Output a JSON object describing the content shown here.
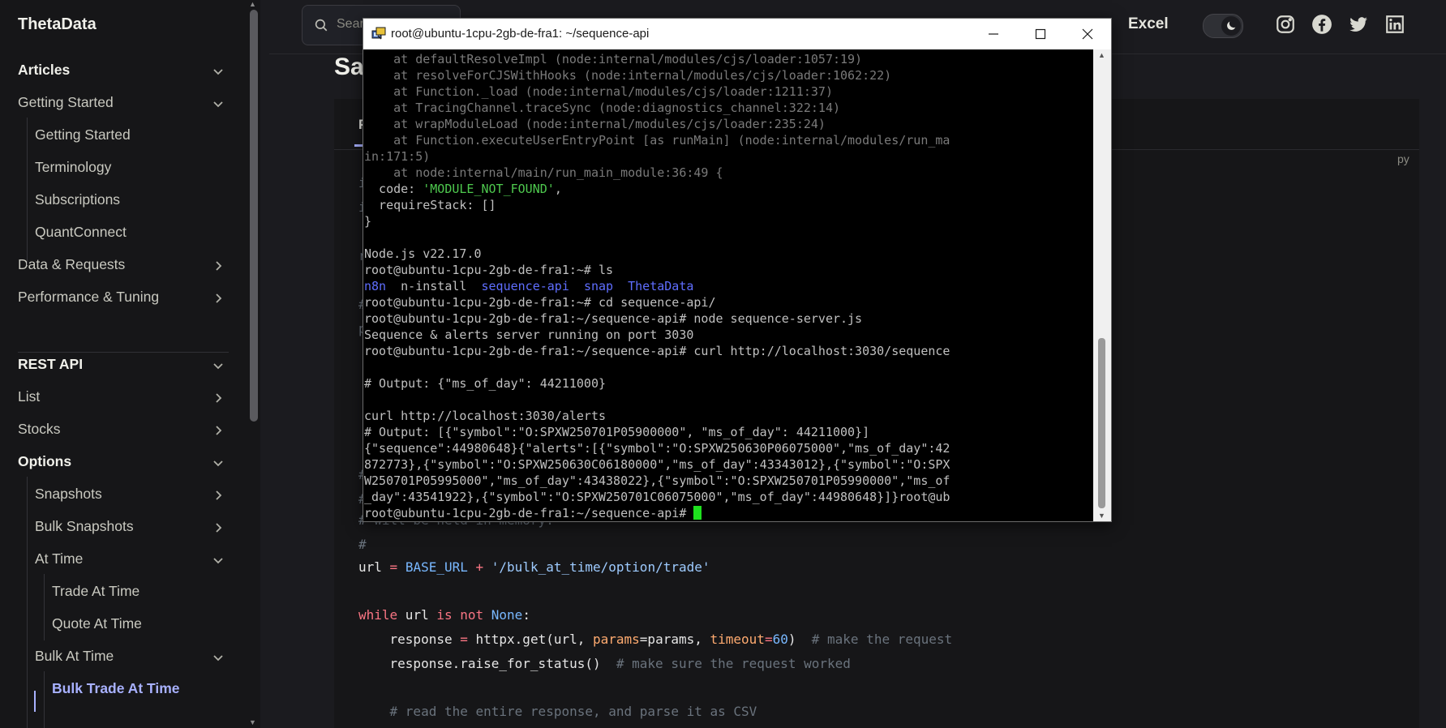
{
  "sidebar": {
    "brand": "ThetaData",
    "items": [
      {
        "label": "Articles",
        "chev": "down"
      },
      {
        "label": "Getting Started",
        "chev": "down"
      },
      {
        "label": "Getting Started"
      },
      {
        "label": "Terminology"
      },
      {
        "label": "Subscriptions"
      },
      {
        "label": "QuantConnect"
      },
      {
        "label": "Data & Requests",
        "chev": "right"
      },
      {
        "label": "Performance & Tuning",
        "chev": "right"
      },
      {
        "label": "REST API",
        "chev": "down"
      },
      {
        "label": "List",
        "chev": "right"
      },
      {
        "label": "Stocks",
        "chev": "right"
      },
      {
        "label": "Options",
        "chev": "down"
      },
      {
        "label": "Snapshots",
        "chev": "right"
      },
      {
        "label": "Bulk Snapshots",
        "chev": "right"
      },
      {
        "label": "At Time",
        "chev": "down"
      },
      {
        "label": "Trade At Time"
      },
      {
        "label": "Quote At Time"
      },
      {
        "label": "Bulk At Time",
        "chev": "down"
      },
      {
        "label": "Bulk Trade At Time"
      }
    ]
  },
  "topbar": {
    "search_placeholder": "Search",
    "excel_label": "Excel",
    "theme_icon": "moon-icon",
    "social": [
      "instagram-icon",
      "facebook-icon",
      "twitter-icon",
      "linkedin-icon"
    ]
  },
  "main": {
    "page_title_fragment": "Sa",
    "tab_fragment": "P",
    "lang_label": "py",
    "comment_partial": "# will be held in memory.",
    "comment_hash": "#",
    "code": {
      "l1_var": "url",
      "l1_op": " = ",
      "l1_const": "BASE_URL",
      "l1_op2": " + ",
      "l1_str": "'/bulk_at_time/option/trade'",
      "l2_kw": "while",
      "l2_var": " url ",
      "l2_kw2": "is not",
      "l2_const": " None",
      "l2_colon": ":",
      "l3_var": "    response ",
      "l3_op": "=",
      "l3_call": " httpx.get(url, ",
      "l3_arg1": "params",
      "l3_eq1": "=params, ",
      "l3_arg2": "timeout",
      "l3_eq2": "=",
      "l3_num": "60",
      "l3_close": ")  ",
      "l3_com": "# make the request",
      "l4_call": "    response.raise_for_status()  ",
      "l4_com": "# make sure the request worked",
      "l5_com": "    # read the entire response, and parse it as CSV"
    }
  },
  "terminal": {
    "title": "root@ubuntu-1cpu-2gb-de-fra1: ~/sequence-api",
    "lines": [
      "    at defaultResolveImpl (node:internal/modules/cjs/loader:1057:19)",
      "    at resolveForCJSWithHooks (node:internal/modules/cjs/loader:1062:22)",
      "    at Function._load (node:internal/modules/cjs/loader:1211:37)",
      "    at TracingChannel.traceSync (node:diagnostics_channel:322:14)",
      "    at wrapModuleLoad (node:internal/modules/cjs/loader:235:24)",
      "    at Function.executeUserEntryPoint [as runMain] (node:internal/modules/run_ma",
      "in:171:5)",
      "    at node:internal/main/run_main_module:36:49 {",
      "  code: ",
      "  requireStack: []",
      "}",
      "",
      "Node.js v22.17.0",
      "root@ubuntu-1cpu-2gb-de-fra1:~# ls",
      "",
      "root@ubuntu-1cpu-2gb-de-fra1:~# cd sequence-api/",
      "root@ubuntu-1cpu-2gb-de-fra1:~/sequence-api# node sequence-server.js",
      "Sequence & alerts server running on port 3030",
      "root@ubuntu-1cpu-2gb-de-fra1:~/sequence-api# curl http://localhost:3030/sequence",
      "",
      "# Output: {\"ms_of_day\": 44211000}",
      "",
      "curl http://localhost:3030/alerts",
      "# Output: [{\"symbol\":\"O:SPXW250701P05900000\", \"ms_of_day\": 44211000}]",
      "{\"sequence\":44980648}{\"alerts\":[{\"symbol\":\"O:SPXW250630P06075000\",\"ms_of_day\":42",
      "872773},{\"symbol\":\"O:SPXW250630C06180000\",\"ms_of_day\":43343012},{\"symbol\":\"O:SPX",
      "W250701P05995000\",\"ms_of_day\":43438022},{\"symbol\":\"O:SPXW250701P05990000\",\"ms_of",
      "_day\":43541922},{\"symbol\":\"O:SPXW250701C06075000\",\"ms_of_day\":44980648}]}root@ub",
      "root@ubuntu-1cpu-2gb-de-fra1:~/sequence-api# "
    ],
    "code_value": "'MODULE_NOT_FOUND'",
    "code_suffix": ",",
    "ls_items": [
      {
        "name": "n8n",
        "color": "blue"
      },
      {
        "name": "n-install",
        "color": "plain"
      },
      {
        "name": "sequence-api",
        "color": "blue"
      },
      {
        "name": "snap",
        "color": "blue"
      },
      {
        "name": "ThetaData",
        "color": "blue"
      }
    ]
  }
}
